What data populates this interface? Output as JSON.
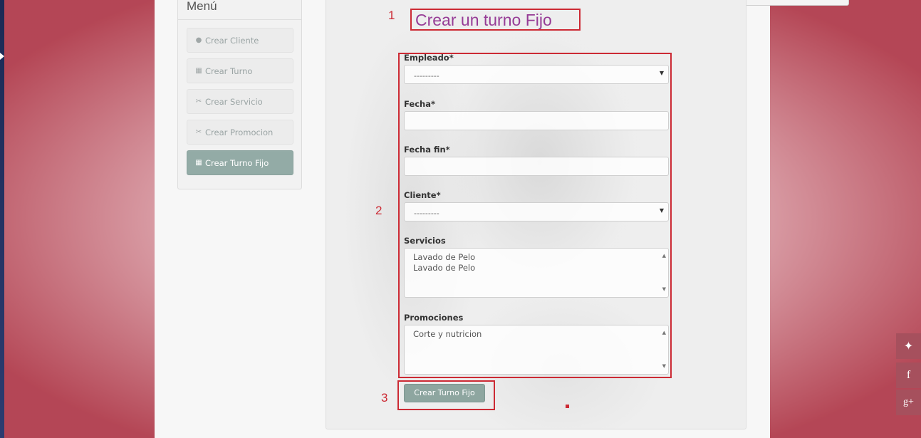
{
  "menu": {
    "title": "Menú",
    "items": [
      {
        "label": "Crear Cliente",
        "icon": "user-icon",
        "glyph": "👤"
      },
      {
        "label": "Crear Turno",
        "icon": "calendar-icon",
        "glyph": "▦"
      },
      {
        "label": "Crear Servicio",
        "icon": "scissors-icon",
        "glyph": "✂"
      },
      {
        "label": "Crear Promocion",
        "icon": "scissors-icon",
        "glyph": "✂"
      },
      {
        "label": "Crear Turno Fijo",
        "icon": "calendar-icon",
        "glyph": "▦",
        "active": true
      }
    ]
  },
  "annotations": {
    "n1": "1",
    "n2": "2",
    "n3": "3",
    "color": "#cc2a34"
  },
  "form": {
    "title": "Crear un turno Fijo",
    "empleado": {
      "label": "Empleado*",
      "value": "---------"
    },
    "fecha": {
      "label": "Fecha*",
      "value": ""
    },
    "fecha_fin": {
      "label": "Fecha fin*",
      "value": ""
    },
    "cliente": {
      "label": "Cliente*",
      "value": "---------"
    },
    "servicios": {
      "label": "Servicios",
      "options": [
        "Lavado de Pelo",
        "Lavado de Pelo"
      ]
    },
    "promociones": {
      "label": "Promociones",
      "options": [
        "Corte y nutricion"
      ]
    },
    "submit_label": "Crear Turno Fijo"
  },
  "social": [
    {
      "name": "twitter-icon",
      "glyph": "🐦"
    },
    {
      "name": "facebook-icon",
      "glyph": "f"
    },
    {
      "name": "google-plus-icon",
      "glyph": "g+"
    }
  ],
  "colors": {
    "accent": "#93aba6",
    "title": "#963c96",
    "background": "#b84a5a"
  }
}
